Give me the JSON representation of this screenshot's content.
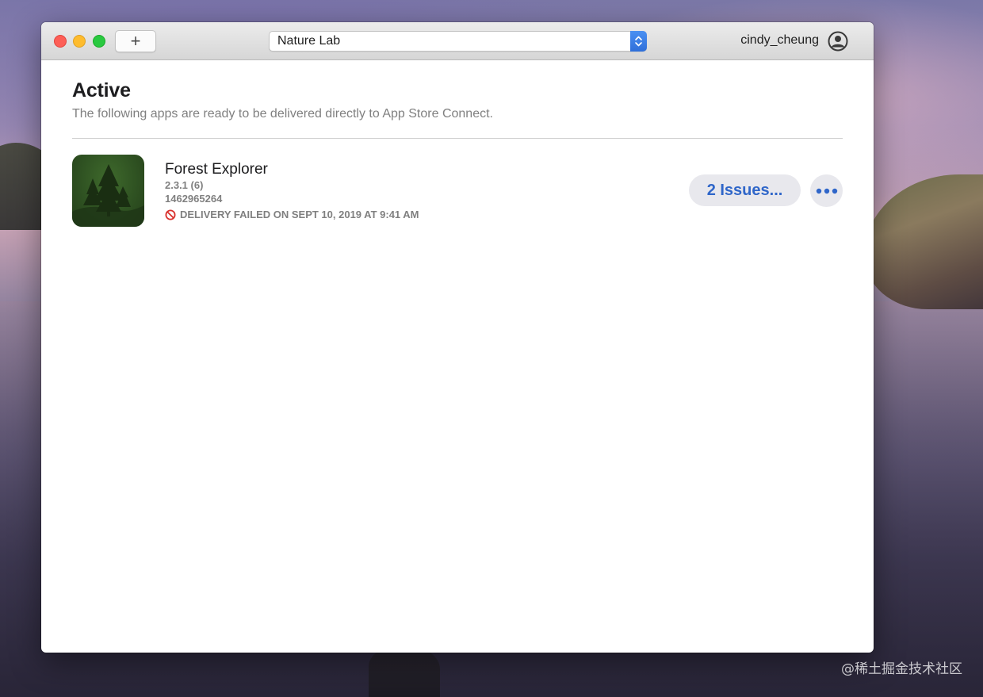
{
  "window": {
    "add_label": "+",
    "team_selector": {
      "value": "Nature Lab"
    },
    "account": {
      "username": "cindy_cheung"
    }
  },
  "section": {
    "title": "Active",
    "subtitle": "The following apps are ready to be delivered directly to App Store Connect."
  },
  "apps": [
    {
      "name": "Forest Explorer",
      "version": "2.3.1 (6)",
      "app_id": "1462965264",
      "status": "DELIVERY FAILED ON SEPT 10, 2019 AT 9:41 AM",
      "issues_label": "2 Issues...",
      "status_icon": "prohibited-icon"
    }
  ],
  "watermark": "@稀土掘金技术社区",
  "colors": {
    "accent": "#2f66c9",
    "error": "#d9302c",
    "icon_green": "#2f5222"
  }
}
